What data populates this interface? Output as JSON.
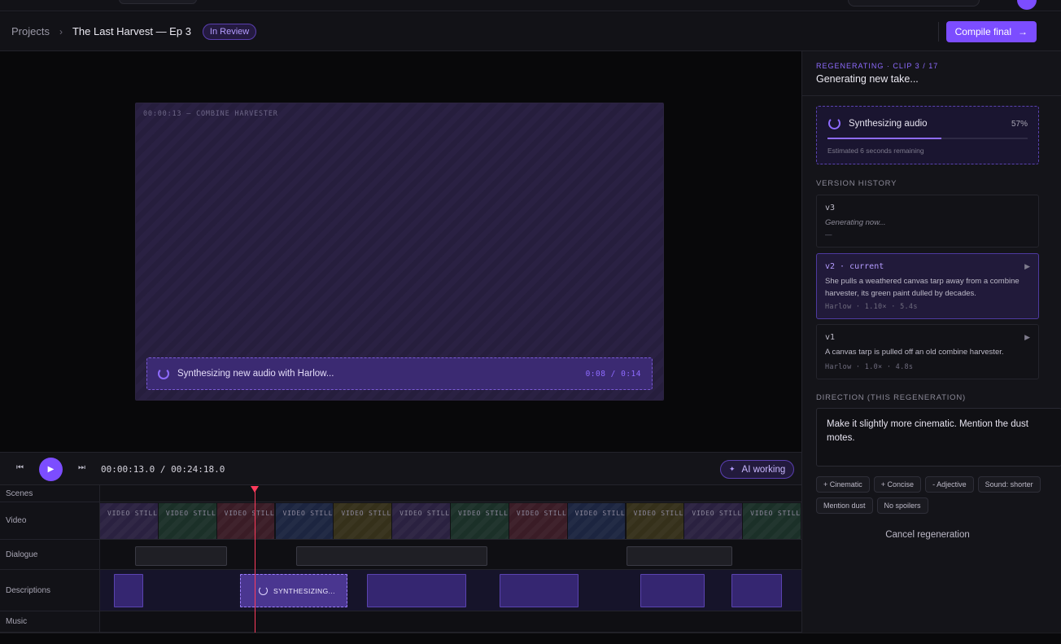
{
  "breadcrumb": {
    "root": "Projects",
    "separator": "›",
    "title": "The Last Harvest — Ep 3",
    "status": "In Review"
  },
  "header": {
    "compile_label": "Compile final",
    "compile_arrow": "→"
  },
  "preview": {
    "frame_label": "00:00:13 — COMBINE HARVESTER",
    "synth_text": "Synthesizing new audio with Harlow...",
    "synth_time": "0:08 / 0:14"
  },
  "transport": {
    "prev_icon": "⏮",
    "play_icon": "▶",
    "next_icon": "⏭",
    "timecode": "00:00:13.0 / 00:24:18.0",
    "ai_label": "AI working",
    "ai_icon": "✦"
  },
  "timeline": {
    "tracks": {
      "scenes": "Scenes",
      "video": "Video",
      "dialogue": "Dialogue",
      "descriptions": "Descriptions",
      "music": "Music"
    },
    "still_label": "VIDEO STILL",
    "still_colors": [
      "#2a2140",
      "#1b3028",
      "#3a1c26",
      "#1c2540",
      "#35301a",
      "#2a2140",
      "#1b3028",
      "#3a1c26",
      "#1c2540",
      "#35301a",
      "#2a2140",
      "#1b3028"
    ],
    "synth_label": "SYNTHESIZING..."
  },
  "panel": {
    "overline": "REGENERATING · CLIP 3 / 17",
    "title": "Generating new take...",
    "progress": {
      "label": "Synthesizing audio",
      "percent_text": "57%",
      "percent": 57,
      "estimate": "Estimated 6 seconds remaining"
    },
    "history_label": "VERSION HISTORY",
    "versions": [
      {
        "tag": "v3",
        "text": "Generating now...",
        "meta": "—"
      },
      {
        "tag": "v2 · current",
        "text": "She pulls a weathered canvas tarp away from a combine harvester, its green paint dulled by decades.",
        "meta": "Harlow · 1.10× · 5.4s",
        "play": "▶"
      },
      {
        "tag": "v1",
        "text": "A canvas tarp is pulled off an old combine harvester.",
        "meta": "Harlow · 1.0× · 4.8s",
        "play": "▶"
      }
    ],
    "direction_label": "DIRECTION (THIS REGENERATION)",
    "direction_text": "Make it slightly more cinematic. Mention the dust motes.",
    "chips": [
      "+ Cinematic",
      "+ Concise",
      "- Adjective",
      "Sound: shorter",
      "Mention dust",
      "No spoilers"
    ],
    "cancel_label": "Cancel regeneration"
  },
  "colors": {
    "accent": "#7c4dff",
    "playhead": "#ff3b5c"
  }
}
